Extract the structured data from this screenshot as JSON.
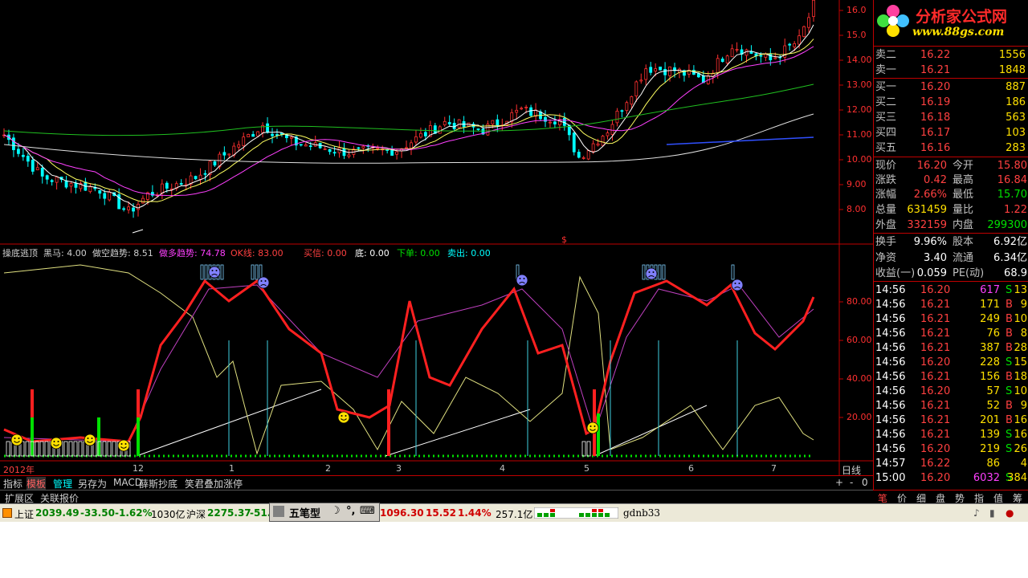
{
  "price_axis": [
    "16.0",
    "15.0",
    "14.00",
    "13.00",
    "12.00",
    "11.00",
    "10.00",
    "9.00",
    "8.00"
  ],
  "osc_axis": [
    "80.00",
    "60.00",
    "40.00",
    "20.00"
  ],
  "indicator_header": {
    "name": "操底逃顶",
    "heima": "黑马: 4.00",
    "zuokong": "做空趋势: 8.51",
    "zuoduo": "做多趋势: 74.78",
    "ok": "OK线: 83.00",
    "maixin": "买信: 0.00",
    "di": "底: 0.00",
    "xiadan": "下单: 0.00",
    "maichu": "卖出: 0.00"
  },
  "x_axis": {
    "year": "2012年",
    "months": [
      "12",
      "1",
      "2",
      "3",
      "4",
      "5",
      "6",
      "7"
    ],
    "period": "日线"
  },
  "marker_s": "$",
  "logo": {
    "title": "分析家公式网",
    "url": "www.88gs.com"
  },
  "order_book": [
    {
      "label": "卖二",
      "price": "16.22",
      "vol": "1556"
    },
    {
      "label": "卖一",
      "price": "16.21",
      "vol": "1848"
    },
    {
      "label": "买一",
      "price": "16.20",
      "vol": "887"
    },
    {
      "label": "买二",
      "price": "16.19",
      "vol": "186"
    },
    {
      "label": "买三",
      "price": "16.18",
      "vol": "563"
    },
    {
      "label": "买四",
      "price": "16.17",
      "vol": "103"
    },
    {
      "label": "买五",
      "price": "16.16",
      "vol": "283"
    }
  ],
  "quote": [
    {
      "l1": "现价",
      "v1": "16.20",
      "l2": "今开",
      "v2": "15.80"
    },
    {
      "l1": "涨跌",
      "v1": "0.42",
      "l2": "最高",
      "v2": "16.84"
    },
    {
      "l1": "涨幅",
      "v1": "2.66%",
      "l2": "最低",
      "v2": "15.70"
    },
    {
      "l1": "总量",
      "v1": "631459",
      "l2": "量比",
      "v2": "1.22"
    },
    {
      "l1": "外盘",
      "v1": "332159",
      "l2": "内盘",
      "v2": "299300"
    }
  ],
  "fundamentals": [
    {
      "l1": "换手",
      "v1": "9.96%",
      "l2": "股本",
      "v2": "6.92亿"
    },
    {
      "l1": "净资",
      "v1": "3.40",
      "l2": "流通",
      "v2": "6.34亿"
    },
    {
      "l1": "收益(一)",
      "v1": "0.059",
      "l2": "PE(动)",
      "v2": "68.9"
    }
  ],
  "ticks": [
    {
      "t": "14:56",
      "p": "16.20",
      "v": "617",
      "s": "S",
      "n": "13"
    },
    {
      "t": "14:56",
      "p": "16.21",
      "v": "171",
      "s": "B",
      "n": "9"
    },
    {
      "t": "14:56",
      "p": "16.21",
      "v": "249",
      "s": "B",
      "n": "10"
    },
    {
      "t": "14:56",
      "p": "16.21",
      "v": "76",
      "s": "B",
      "n": "8"
    },
    {
      "t": "14:56",
      "p": "16.21",
      "v": "387",
      "s": "B",
      "n": "28"
    },
    {
      "t": "14:56",
      "p": "16.20",
      "v": "228",
      "s": "S",
      "n": "15"
    },
    {
      "t": "14:56",
      "p": "16.21",
      "v": "156",
      "s": "B",
      "n": "18"
    },
    {
      "t": "14:56",
      "p": "16.20",
      "v": "57",
      "s": "S",
      "n": "10"
    },
    {
      "t": "14:56",
      "p": "16.21",
      "v": "52",
      "s": "B",
      "n": "9"
    },
    {
      "t": "14:56",
      "p": "16.21",
      "v": "201",
      "s": "B",
      "n": "16"
    },
    {
      "t": "14:56",
      "p": "16.21",
      "v": "139",
      "s": "S",
      "n": "16"
    },
    {
      "t": "14:56",
      "p": "16.20",
      "v": "219",
      "s": "S",
      "n": "26"
    },
    {
      "t": "14:57",
      "p": "16.22",
      "v": "86",
      "s": "",
      "n": "4"
    },
    {
      "t": "15:00",
      "p": "16.20",
      "v": "6032",
      "s": "S",
      "n": "384"
    }
  ],
  "bottom_tabs": [
    "指标",
    "模板",
    "管理",
    "另存为",
    "MACD",
    "薛斯抄底",
    "笑君叠加涨停"
  ],
  "tab_controls": [
    "+",
    "-",
    "0"
  ],
  "bottom_tabs2": [
    "扩展区",
    "关联报价"
  ],
  "right_tabs": [
    "笔",
    "价",
    "细",
    "盘",
    "势",
    "指",
    "值",
    "筹"
  ],
  "status": {
    "sh_label": "上证",
    "sh_val": "2039.49",
    "sh_chg": "-33.50",
    "sh_pct": "-1.62%",
    "sh_amt": "1030亿",
    "hs_label": "沪深",
    "hs_val": "2275.37",
    "hs_chg": "-51.",
    "ime_label": "五笔型",
    "idx_val": "1096.30",
    "idx_chg": "15.52",
    "idx_pct": "1.44%",
    "idx_amt": "257.1亿",
    "user": "gdnb33"
  },
  "colors": {
    "up": "#ff3030",
    "down": "#00ffff",
    "background": "#000000",
    "grid": "#c00000"
  }
}
